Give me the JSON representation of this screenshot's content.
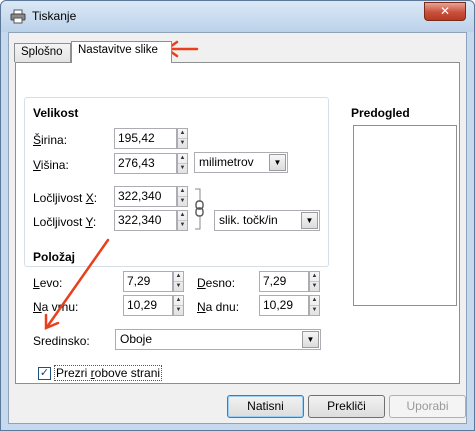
{
  "window": {
    "title": "Tiskanje",
    "close_glyph": "✕",
    "icon": "printer-icon"
  },
  "tabs": [
    {
      "label": "Splošno",
      "active": false
    },
    {
      "label": "Nastavitve slike",
      "active": true
    }
  ],
  "size": {
    "title": "Velikost",
    "width_label": {
      "key": "Š",
      "rest": "irina:"
    },
    "width_value": "195,42",
    "height_label": {
      "key": "V",
      "rest": "išina:"
    },
    "height_value": "276,43",
    "unit_selected": "milimetrov",
    "res_x_label": {
      "pre": "Ločljivost ",
      "key": "X",
      "post": ":"
    },
    "res_x_value": "322,340",
    "res_y_label": {
      "pre": "Ločljivost ",
      "key": "Y",
      "post": ":"
    },
    "res_y_value": "322,340",
    "res_unit_selected": "slik. točk/in"
  },
  "preview": {
    "title": "Predogled"
  },
  "position": {
    "title": "Položaj",
    "left_label": {
      "key": "L",
      "rest": "evo:"
    },
    "left_value": "7,29",
    "right_label": {
      "key": "D",
      "rest": "esno:"
    },
    "right_value": "7,29",
    "top_label": {
      "key": "N",
      "rest": "a vrhu:"
    },
    "top_value": "10,29",
    "bottom_label": {
      "key": "N",
      "rest": "a dnu:"
    },
    "bottom_value": "10,29",
    "center_label": "Sredinsko:",
    "center_selected": "Oboje"
  },
  "ignore_margins": {
    "pre": "Prezri ",
    "key": "r",
    "post": "obove strani",
    "checked": true
  },
  "buttons": {
    "print": "Natisni",
    "cancel": "Prekliči",
    "apply": "Uporabi"
  },
  "colors": {
    "annotation_arrow": "#e8401c",
    "titlebar": "#c6d9ee"
  }
}
